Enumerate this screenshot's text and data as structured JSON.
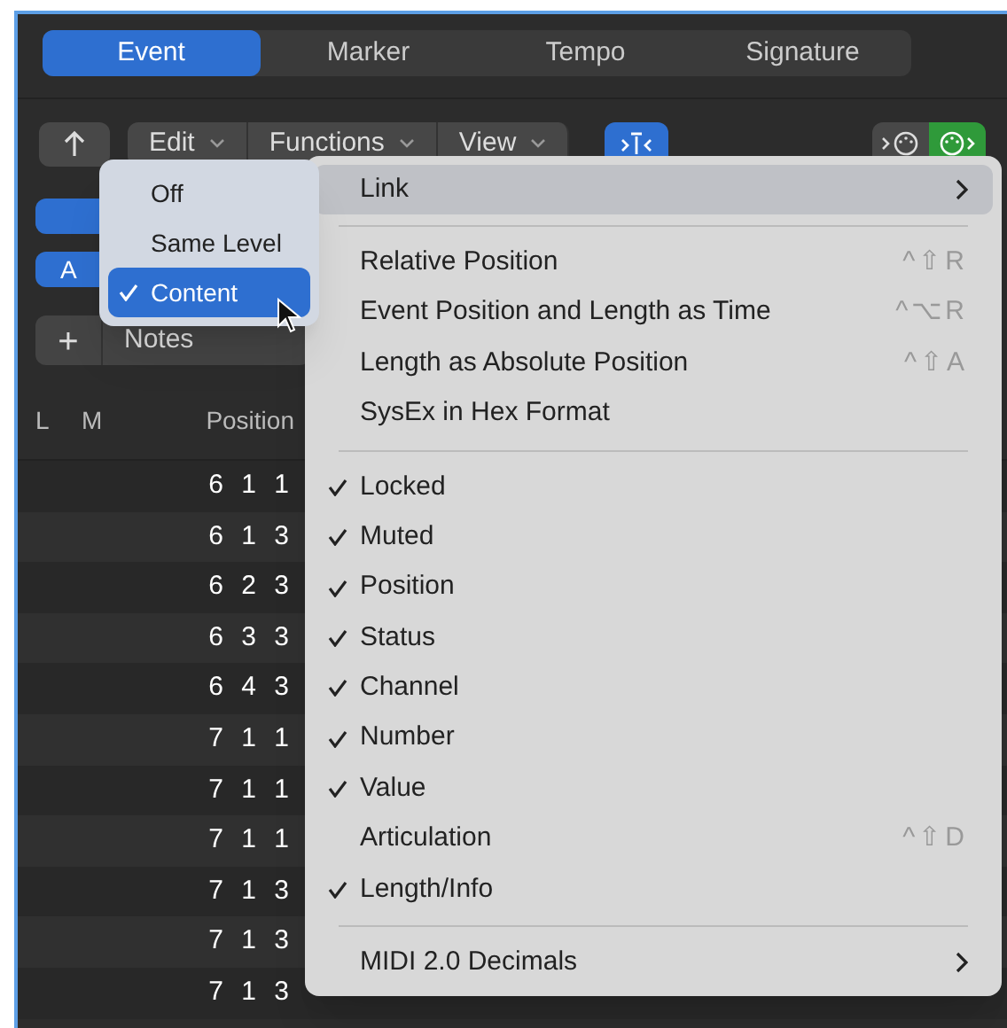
{
  "tabs": [
    {
      "label": "Event",
      "selected": true
    },
    {
      "label": "Marker",
      "selected": false
    },
    {
      "label": "Tempo",
      "selected": false
    },
    {
      "label": "Signature",
      "selected": false
    }
  ],
  "toolbar": {
    "menus": [
      "Edit",
      "Functions",
      "View"
    ],
    "catch_on": true,
    "midi_in_on": false,
    "midi_out_on": true
  },
  "left_panel": {
    "button_label": "A",
    "add_label": "+",
    "filter_label": "Notes"
  },
  "table": {
    "columns": [
      "L",
      "M",
      "Position"
    ],
    "rows": [
      [
        "",
        "",
        "6 1 1"
      ],
      [
        "",
        "",
        "6 1 3"
      ],
      [
        "",
        "",
        "6 2 3"
      ],
      [
        "",
        "",
        "6 3 3"
      ],
      [
        "",
        "",
        "6 4 3"
      ],
      [
        "",
        "",
        "7 1 1"
      ],
      [
        "",
        "",
        "7 1 1"
      ],
      [
        "",
        "",
        "7 1 1"
      ],
      [
        "",
        "",
        "7 1 3"
      ],
      [
        "",
        "",
        "7 1 3"
      ],
      [
        "",
        "",
        "7 1 3"
      ]
    ]
  },
  "menu": [
    {
      "kind": "submenu",
      "label": "Link",
      "selected": true
    },
    {
      "kind": "separator"
    },
    {
      "kind": "item",
      "label": "Relative Position",
      "shortcut": "^⇧R"
    },
    {
      "kind": "item",
      "label": "Event Position and Length as Time",
      "shortcut": "^⌥R"
    },
    {
      "kind": "item",
      "label": "Length as Absolute Position",
      "shortcut": "^⇧A"
    },
    {
      "kind": "item",
      "label": "SysEx in Hex Format"
    },
    {
      "kind": "separator"
    },
    {
      "kind": "check",
      "label": "Locked",
      "checked": true
    },
    {
      "kind": "check",
      "label": "Muted",
      "checked": true
    },
    {
      "kind": "check",
      "label": "Position",
      "checked": true
    },
    {
      "kind": "check",
      "label": "Status",
      "checked": true
    },
    {
      "kind": "check",
      "label": "Channel",
      "checked": true
    },
    {
      "kind": "check",
      "label": "Number",
      "checked": true
    },
    {
      "kind": "check",
      "label": "Value",
      "checked": true
    },
    {
      "kind": "check",
      "label": "Articulation",
      "checked": false,
      "shortcut": "^⇧D"
    },
    {
      "kind": "check",
      "label": "Length/Info",
      "checked": true
    },
    {
      "kind": "separator"
    },
    {
      "kind": "submenu",
      "label": "MIDI 2.0 Decimals",
      "selected": false
    }
  ],
  "submenu": [
    {
      "label": "Off",
      "checked": false,
      "selected": false
    },
    {
      "label": "Same Level",
      "checked": false,
      "selected": false
    },
    {
      "label": "Content",
      "checked": true,
      "selected": true
    }
  ]
}
